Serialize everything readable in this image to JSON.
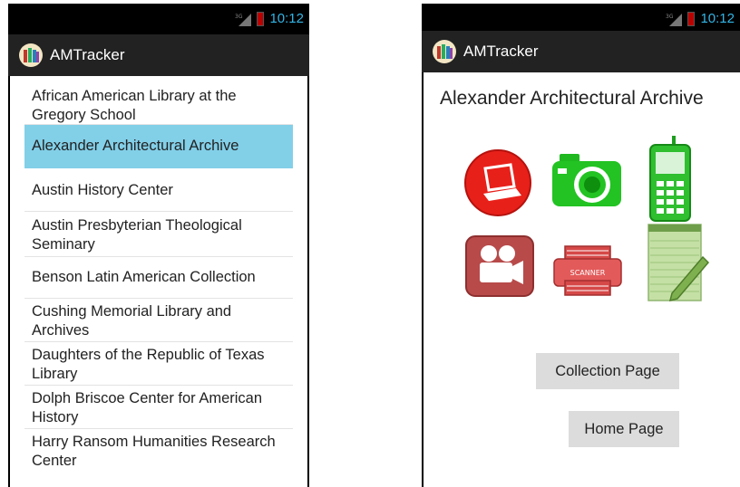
{
  "status_bar": {
    "time": "10:12",
    "network": "3G"
  },
  "action_bar": {
    "title": "AMTracker"
  },
  "library_list": {
    "items": [
      "African American Library at the Gregory School",
      "Alexander Architectural Archive",
      "Austin History Center",
      "Austin Presbyterian Theological Seminary",
      "Benson Latin American Collection",
      "Cushing Memorial Library and Archives",
      "Daughters of the Republic of Texas Library",
      "Dolph Briscoe Center for American History",
      "Harry Ransom Humanities Research Center"
    ],
    "selected_index": 1
  },
  "detail": {
    "title": "Alexander Architectural Archive",
    "icons": [
      "laptop-icon",
      "camera-icon",
      "phone-icon",
      "video-camera-icon",
      "scanner-icon",
      "notepad-icon"
    ],
    "scanner_label": "SCANNER",
    "collection_button": "Collection Page",
    "home_button": "Home Page"
  },
  "colors": {
    "status_text": "#33b5e5",
    "action_bar": "#222222",
    "selected_item": "#82cfe8",
    "button_bg": "#dcdcdc"
  }
}
